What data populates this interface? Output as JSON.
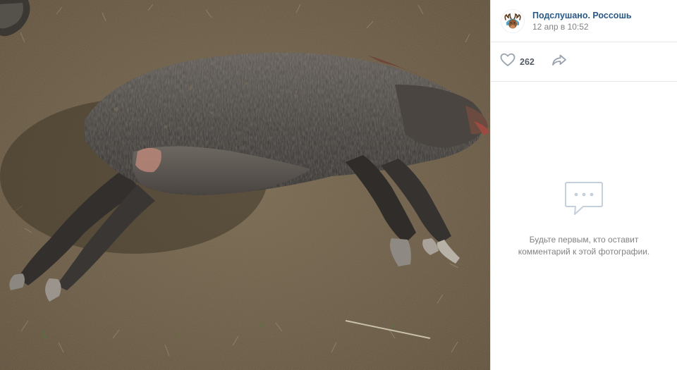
{
  "author": {
    "group_name": "Подслушано. Россошь",
    "post_date": "12 апр в 10:52",
    "avatar_icon": "moose-avatar-icon"
  },
  "actions": {
    "like_icon": "heart-icon",
    "like_count": "262",
    "share_icon": "share-arrow-icon"
  },
  "comments": {
    "empty_icon": "comment-bubble-icon",
    "empty_line1": "Будьте первым, кто оставит",
    "empty_line2": "комментарий к этой фотографии."
  },
  "colors": {
    "link": "#2a5885",
    "muted": "#828282",
    "divider": "#e7e8ec",
    "icon": "#99a2ad"
  }
}
